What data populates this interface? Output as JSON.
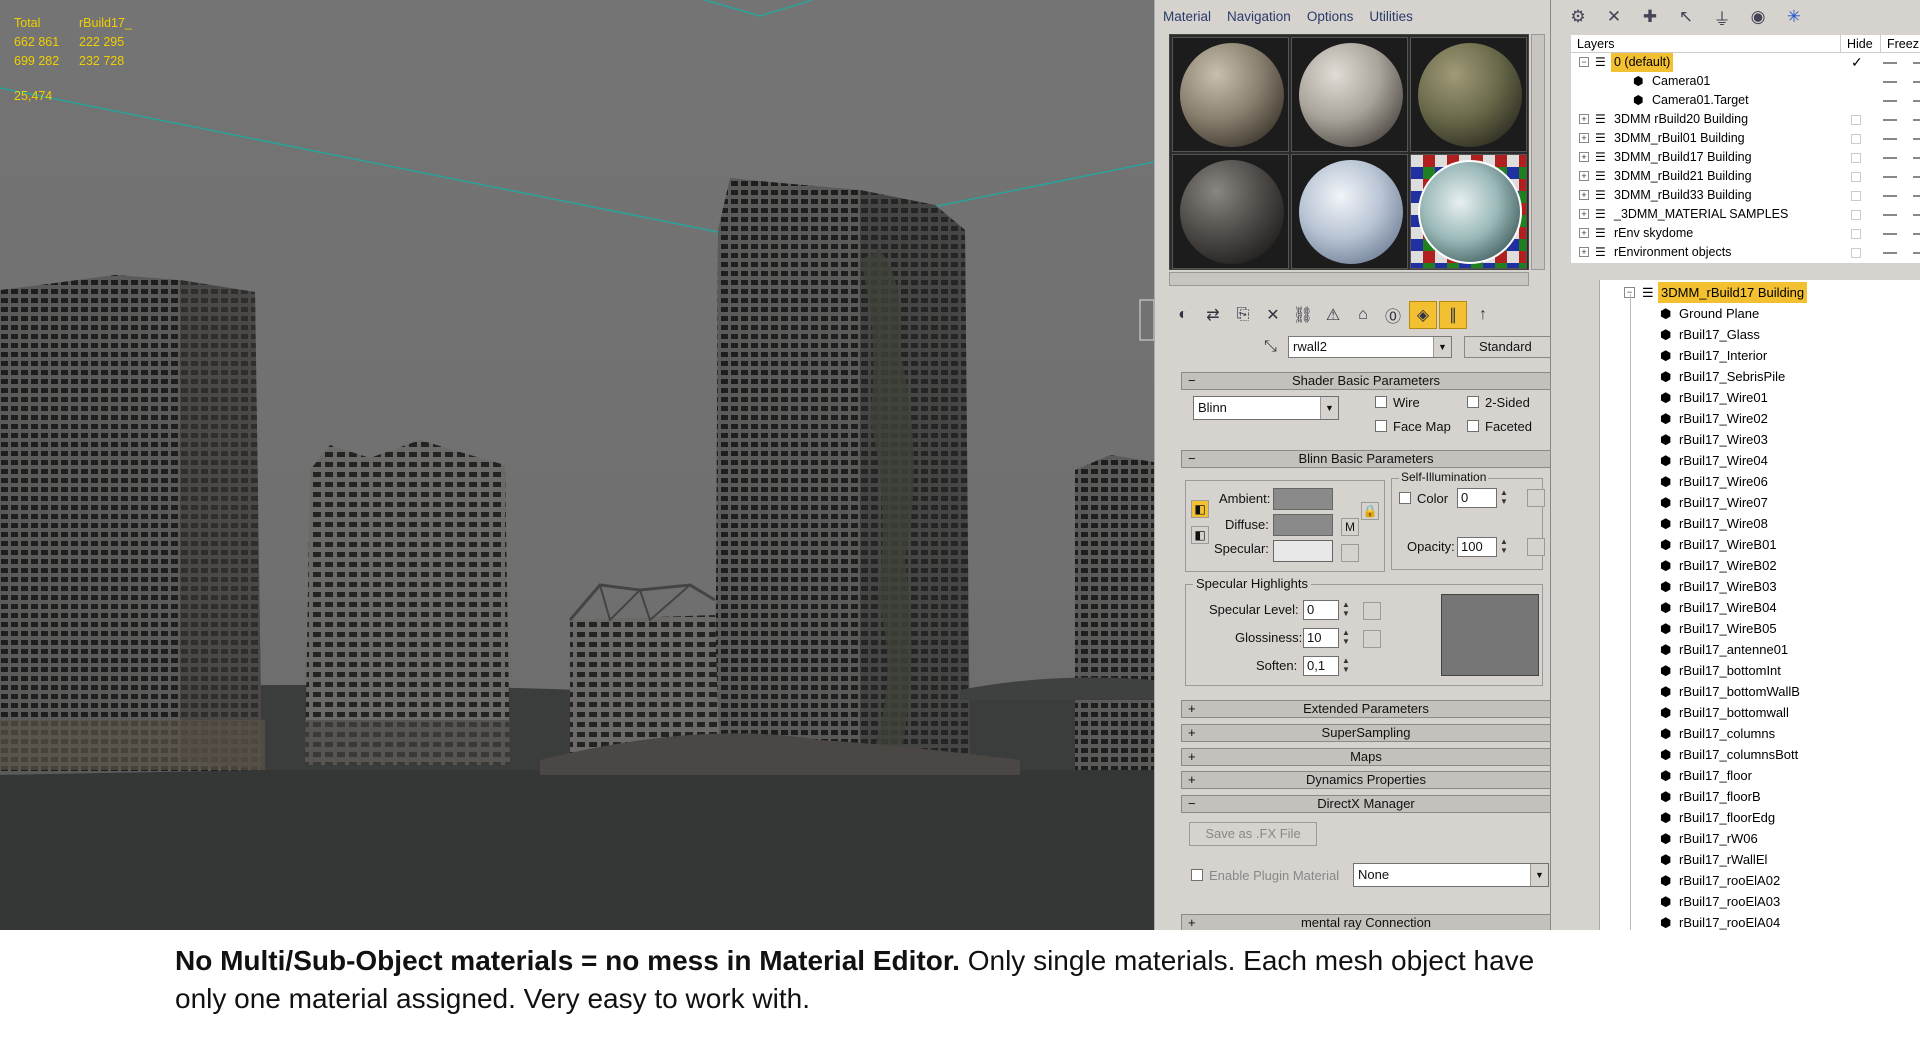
{
  "viewport": {
    "stats": {
      "row1": [
        "Total",
        "rBuild17_"
      ],
      "row2": [
        "662 861",
        "222 295"
      ],
      "row3": [
        "699 282",
        "232 728"
      ]
    },
    "fps": "25,474"
  },
  "material_editor": {
    "menu": [
      "Material",
      "Navigation",
      "Options",
      "Utilities"
    ],
    "material_name": "rwall2",
    "material_type": "Standard",
    "shader_rollout": "Shader Basic Parameters",
    "shader": "Blinn",
    "wire": "Wire",
    "two_sided": "2-Sided",
    "face_map": "Face Map",
    "faceted": "Faceted",
    "blinn_rollout": "Blinn Basic Parameters",
    "self_illum": "Self-Illumination",
    "color_label": "Color",
    "color_value": "0",
    "ambient": "Ambient:",
    "diffuse": "Diffuse:",
    "specular": "Specular:",
    "lock_m": "M",
    "opacity_label": "Opacity:",
    "opacity_value": "100",
    "spec_highlights": "Specular Highlights",
    "spec_level_label": "Specular Level:",
    "spec_level": "0",
    "gloss_label": "Glossiness:",
    "gloss": "10",
    "soften_label": "Soften:",
    "soften": "0,1",
    "rollouts": [
      "Extended Parameters",
      "SuperSampling",
      "Maps",
      "Dynamics Properties",
      "DirectX Manager"
    ],
    "save_fx": "Save as .FX File",
    "enable_plugin": "Enable Plugin Material",
    "plugin_value": "None",
    "mental_ray": "mental ray Connection"
  },
  "explorer": {
    "headers": [
      "Layers",
      "Hide",
      "Freez"
    ],
    "layers": [
      {
        "name": "0 (default)",
        "indent": 0,
        "toggle": "−",
        "selected": true
      },
      {
        "name": "Camera01",
        "indent": 1,
        "toggle": ""
      },
      {
        "name": "Camera01.Target",
        "indent": 1,
        "toggle": ""
      },
      {
        "name": "3DMM rBuild20 Building",
        "indent": 0,
        "toggle": "+"
      },
      {
        "name": "3DMM_rBuil01 Building",
        "indent": 0,
        "toggle": "+"
      },
      {
        "name": "3DMM_rBuild17 Building",
        "indent": 0,
        "toggle": "+"
      },
      {
        "name": "3DMM_rBuild21 Building",
        "indent": 0,
        "toggle": "+"
      },
      {
        "name": "3DMM_rBuild33 Building",
        "indent": 0,
        "toggle": "+"
      },
      {
        "name": "_3DMM_MATERIAL SAMPLES",
        "indent": 0,
        "toggle": "+"
      },
      {
        "name": "rEnv skydome",
        "indent": 0,
        "toggle": "+"
      },
      {
        "name": "rEnvironment objects",
        "indent": 0,
        "toggle": "+"
      }
    ],
    "building_layer": "3DMM_rBuild17 Building",
    "objects": [
      "Ground Plane",
      "rBuil17_Glass",
      "rBuil17_Interior",
      "rBuil17_SebrisPile",
      "rBuil17_Wire01",
      "rBuil17_Wire02",
      "rBuil17_Wire03",
      "rBuil17_Wire04",
      "rBuil17_Wire06",
      "rBuil17_Wire07",
      "rBuil17_Wire08",
      "rBuil17_WireB01",
      "rBuil17_WireB02",
      "rBuil17_WireB03",
      "rBuil17_WireB04",
      "rBuil17_WireB05",
      "rBuil17_antenne01",
      "rBuil17_bottomInt",
      "rBuil17_bottomWallB",
      "rBuil17_bottomwall",
      "rBuil17_columns",
      "rBuil17_columnsBott",
      "rBuil17_floor",
      "rBuil17_floorB",
      "rBuil17_floorEdg",
      "rBuil17_rW06",
      "rBuil17_rWallEl",
      "rBuil17_rooElA02",
      "rBuil17_rooElA03",
      "rBuil17_rooElA04"
    ]
  },
  "caption": {
    "bold": "No Multi/Sub-Object materials = no mess in Material Editor.",
    "normal": " Only single materials. Each mesh object have",
    "line2": "only one material assigned. Very easy to work with."
  },
  "colors": {
    "highlight": "#f2c030",
    "stats_text": "#f0d000",
    "panel": "#d6d3ce"
  }
}
